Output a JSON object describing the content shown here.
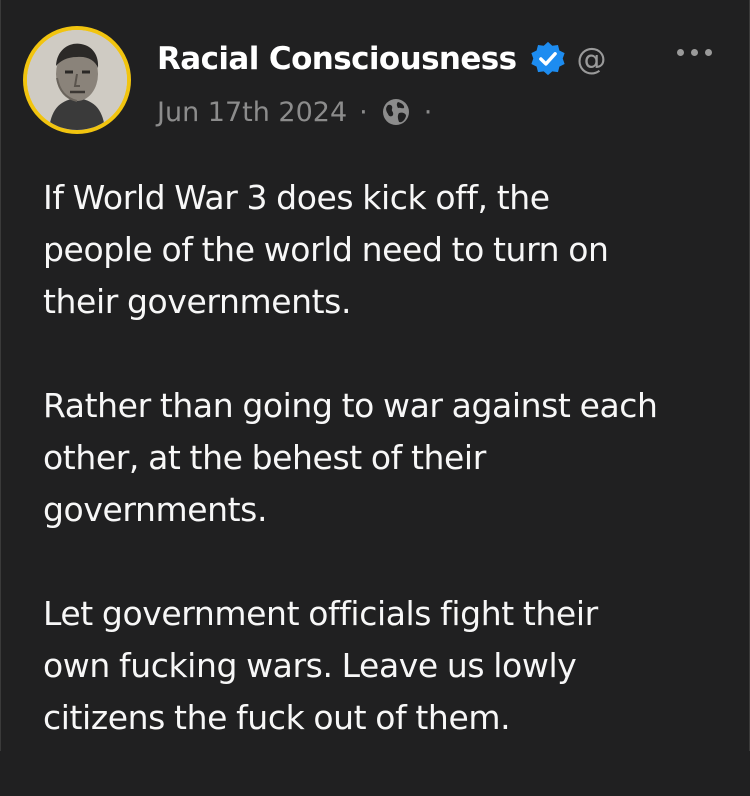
{
  "author": {
    "display_name": "Racial Consciousness",
    "at_symbol": "@",
    "avatar_icon": "portrait-avatar",
    "verified_icon": "verified-badge-icon",
    "ring_color": "#f1c40f",
    "badge_color": "#1d8cf0"
  },
  "meta": {
    "date": "Jun 17th 2024",
    "separator": "·",
    "visibility_icon": "globe-icon"
  },
  "actions": {
    "more_icon": "more-icon"
  },
  "post": {
    "paragraphs": [
      {
        "lines": [
          "If World War 3 does kick off, the",
          "people of the world need to turn on",
          "their governments."
        ]
      },
      {
        "lines": [
          "Rather than going to war against each",
          "other, at the behest of their",
          "governments."
        ]
      },
      {
        "lines": [
          "Let government officials fight their",
          "own fucking wars. Leave us lowly",
          "citizens the fuck out of them."
        ]
      }
    ]
  }
}
